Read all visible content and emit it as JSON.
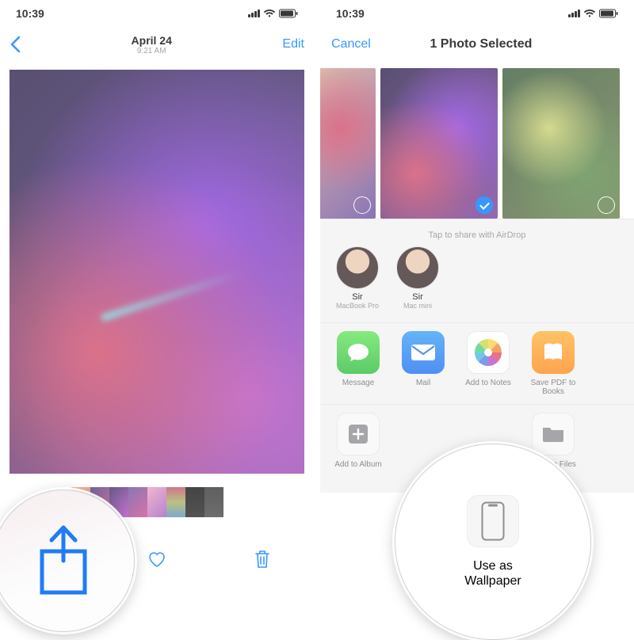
{
  "left": {
    "status_time": "10:39",
    "nav": {
      "title": "April 24",
      "subtitle": "9:21 AM",
      "edit": "Edit"
    },
    "share_icon_name": "share-icon"
  },
  "right": {
    "status_time": "10:39",
    "nav": {
      "cancel": "Cancel",
      "title": "1 Photo Selected"
    },
    "airdrop_hint": "Tap to share with AirDrop",
    "airdrop": [
      {
        "name": "Sir",
        "device": "MacBook Pro"
      },
      {
        "name": "Sir",
        "device": "Mac mini"
      }
    ],
    "apps": [
      {
        "label": "Message"
      },
      {
        "label": "Mail"
      },
      {
        "label": "Add to Notes"
      },
      {
        "label": "Save PDF to Books"
      }
    ],
    "actions": [
      {
        "label": "Add to Album"
      },
      {
        "label": "Use as Wallpaper"
      },
      {
        "label": "Save to Files"
      }
    ],
    "callout": {
      "line1": "Use as",
      "line2": "Wallpaper"
    }
  }
}
